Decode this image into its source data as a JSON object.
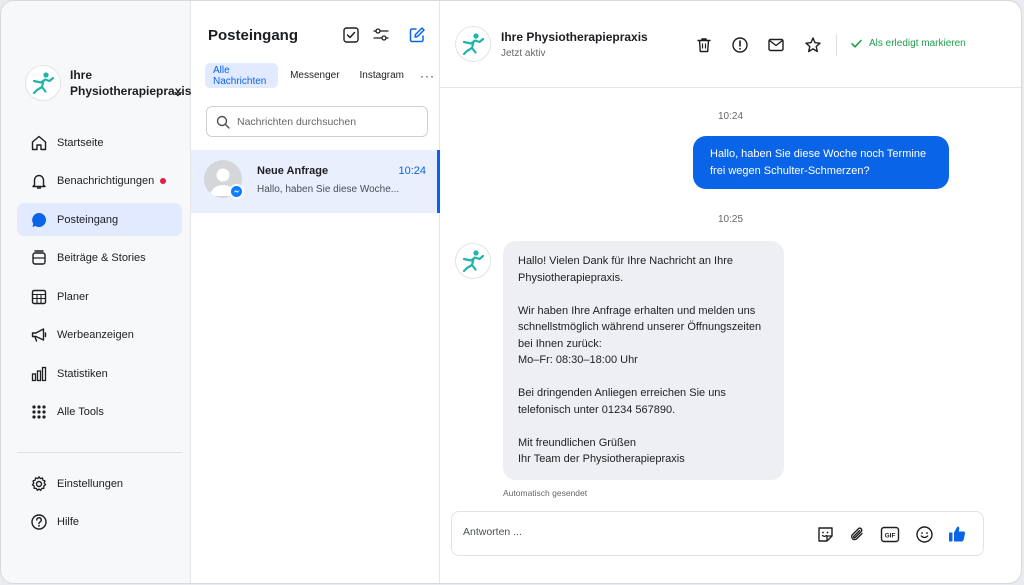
{
  "brand": {
    "name": "Ihre Physiotherapiepraxis"
  },
  "colors": {
    "accent": "#0a64e8",
    "logo": "#1fb5a8",
    "badge_red": "#e41e3f",
    "success": "#1e9e4c"
  },
  "sidebar": {
    "items": [
      {
        "label": "Startseite",
        "icon": "home-icon"
      },
      {
        "label": "Benachrichtigungen",
        "icon": "bell-icon",
        "has_dot": true
      },
      {
        "label": "Posteingang",
        "icon": "chat-bubble-icon",
        "active": true
      },
      {
        "label": "Beiträge & Stories",
        "icon": "posts-icon"
      },
      {
        "label": "Planer",
        "icon": "calendar-grid-icon"
      },
      {
        "label": "Werbeanzeigen",
        "icon": "megaphone-icon"
      },
      {
        "label": "Statistiken",
        "icon": "bar-chart-icon"
      },
      {
        "label": "Alle Tools",
        "icon": "grid-dots-icon"
      }
    ],
    "bottom": [
      {
        "label": "Einstellungen",
        "icon": "gear-icon"
      },
      {
        "label": "Hilfe",
        "icon": "help-icon"
      }
    ]
  },
  "inbox": {
    "title": "Posteingang",
    "tabs": [
      {
        "label": "Alle Nachrichten",
        "active": true
      },
      {
        "label": "Messenger"
      },
      {
        "label": "Instagram"
      }
    ],
    "more": "···",
    "search_placeholder": "Nachrichten durchsuchen",
    "conversations": [
      {
        "name": "Neue Anfrage",
        "time": "10:24",
        "preview": "Hallo, haben Sie diese Woche...",
        "channel": "messenger"
      }
    ]
  },
  "chat": {
    "name": "Ihre Physiotherapiepraxis",
    "status": "Jetzt aktiv",
    "mark_done": "Als erledigt markieren",
    "messages": [
      {
        "time": "10:24",
        "direction": "out",
        "text": "Hallo, haben Sie diese Woche noch Termine frei wegen Schulter-Schmerzen?"
      },
      {
        "time": "10:25",
        "direction": "in",
        "paragraphs": [
          "Hallo! Vielen Dank für Ihre Nachricht an Ihre Physiotherapiepraxis.",
          "Wir haben Ihre Anfrage erhalten und melden uns schnellstmöglich während unserer Öffnungszeiten bei Ihnen zurück:\nMo–Fr: 08:30–18:00 Uhr",
          "Bei dringenden Anliegen erreichen Sie uns telefonisch unter 01234 567890.",
          "Mit freundlichen Grüßen\nIhr Team der Physiotherapiepraxis"
        ],
        "footer": "Automatisch gesendet"
      }
    ],
    "composer_placeholder": "Antworten ...",
    "composer_icons": [
      "sticker-icon",
      "paperclip-icon",
      "gif-icon",
      "emoji-icon",
      "thumbs-up-icon"
    ]
  }
}
